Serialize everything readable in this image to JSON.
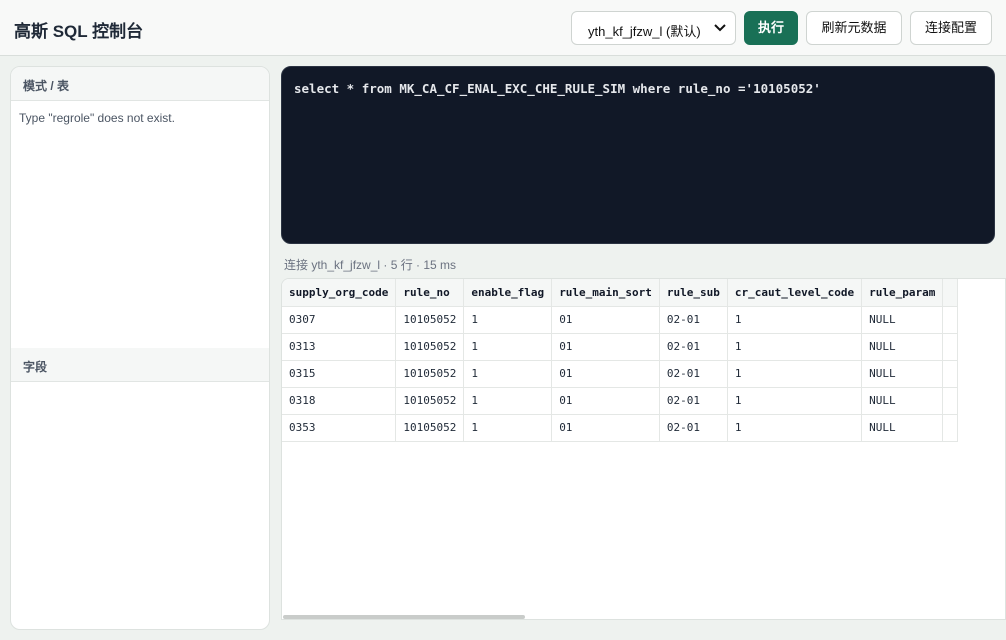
{
  "app": {
    "title": "高斯 SQL 控制台"
  },
  "toolbar": {
    "connection": "yth_kf_jfzw_l (默认)",
    "run_label": "执行",
    "refresh_label": "刷新元数据",
    "config_label": "连接配置"
  },
  "sidebar": {
    "schema_title": "模式 / 表",
    "schema_message": "Type \"regrole\" does not exist.",
    "fields_title": "字段"
  },
  "editor": {
    "sql": "select * from MK_CA_CF_ENAL_EXC_CHE_RULE_SIM where rule_no ='10105052'"
  },
  "status": {
    "text": "连接 yth_kf_jfzw_l · 5 行 · 15 ms"
  },
  "results": {
    "columns": [
      "supply_org_code",
      "rule_no",
      "enable_flag",
      "rule_main_sort",
      "rule_sub",
      "cr_caut_level_code",
      "rule_param"
    ],
    "rows": [
      [
        "0307",
        "10105052",
        "1",
        "01",
        "02-01",
        "1",
        "NULL"
      ],
      [
        "0313",
        "10105052",
        "1",
        "01",
        "02-01",
        "1",
        "NULL"
      ],
      [
        "0315",
        "10105052",
        "1",
        "01",
        "02-01",
        "1",
        "NULL"
      ],
      [
        "0318",
        "10105052",
        "1",
        "01",
        "02-01",
        "1",
        "NULL"
      ],
      [
        "0353",
        "10105052",
        "1",
        "01",
        "02-01",
        "1",
        "NULL"
      ]
    ]
  }
}
